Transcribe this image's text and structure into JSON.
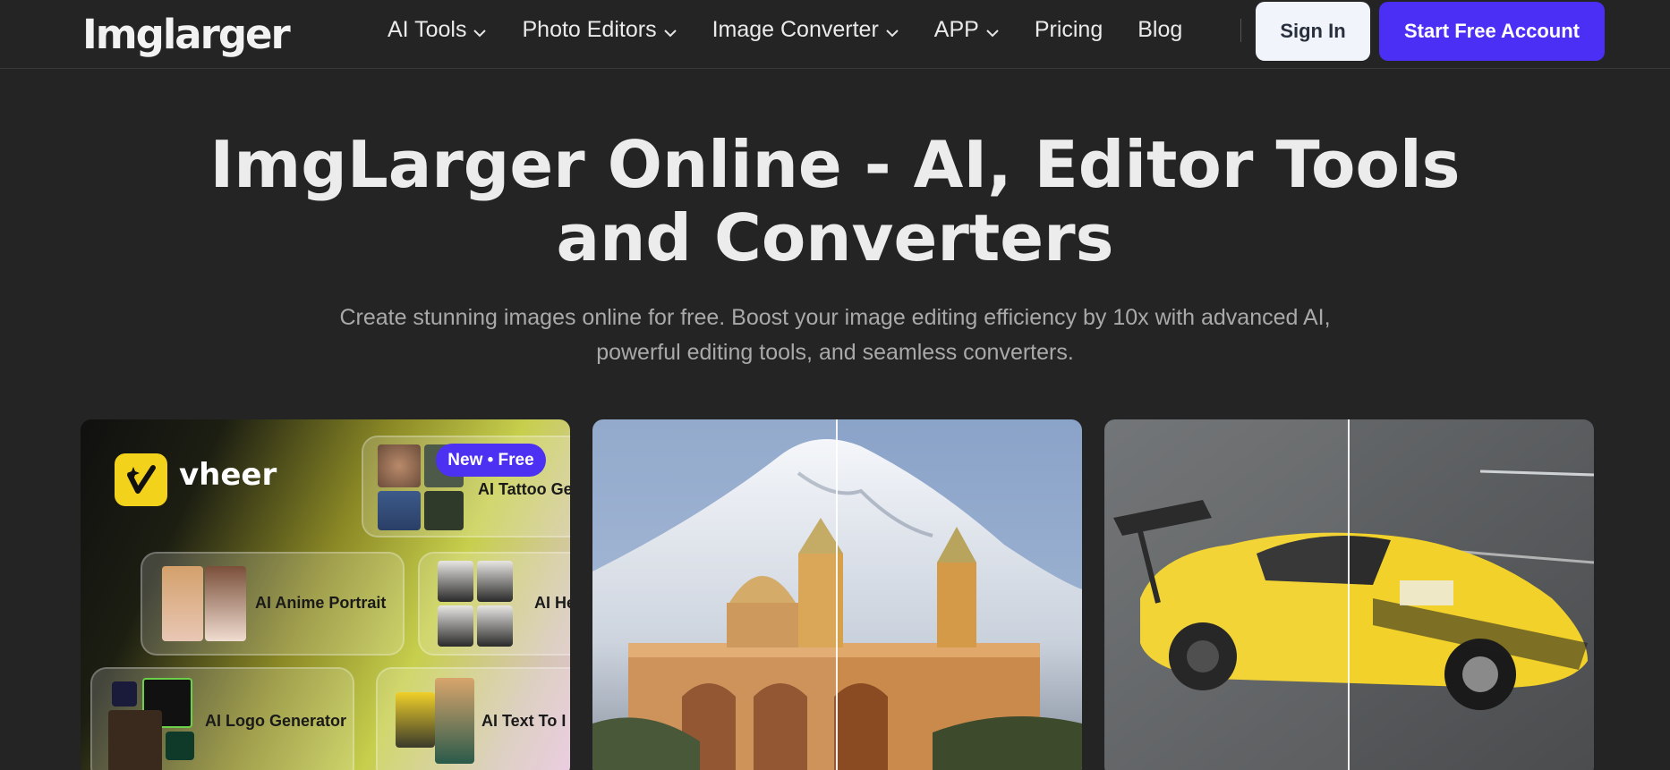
{
  "header": {
    "logo_text": "Imglarger",
    "nav": [
      {
        "label": "AI Tools",
        "has_dropdown": true
      },
      {
        "label": "Photo Editors",
        "has_dropdown": true
      },
      {
        "label": "Image Converter",
        "has_dropdown": true
      },
      {
        "label": "APP",
        "has_dropdown": true
      },
      {
        "label": "Pricing",
        "has_dropdown": false
      },
      {
        "label": "Blog",
        "has_dropdown": false
      }
    ],
    "sign_in_label": "Sign In",
    "start_label": "Start Free Account"
  },
  "hero": {
    "title_line1": "ImgLarger Online - AI, Editor Tools",
    "title_line2": "and Converters",
    "subtitle_line1": "Create stunning images online for free. Boost your image editing efficiency by 10x with advanced AI,",
    "subtitle_line2": "powerful editing tools, and seamless converters."
  },
  "cards": {
    "vheer": {
      "brand": "vheer",
      "badge": "New • Free",
      "tiles": [
        "AI Tattoo Ge",
        "AI Anime Portrait",
        "AI He",
        "AI Logo Generator",
        "AI Text To I"
      ]
    }
  },
  "colors": {
    "background": "#242424",
    "accent": "#4b2ff5",
    "sign_in_bg": "#f1f5fb",
    "vheer_yellow": "#f3d21b"
  }
}
